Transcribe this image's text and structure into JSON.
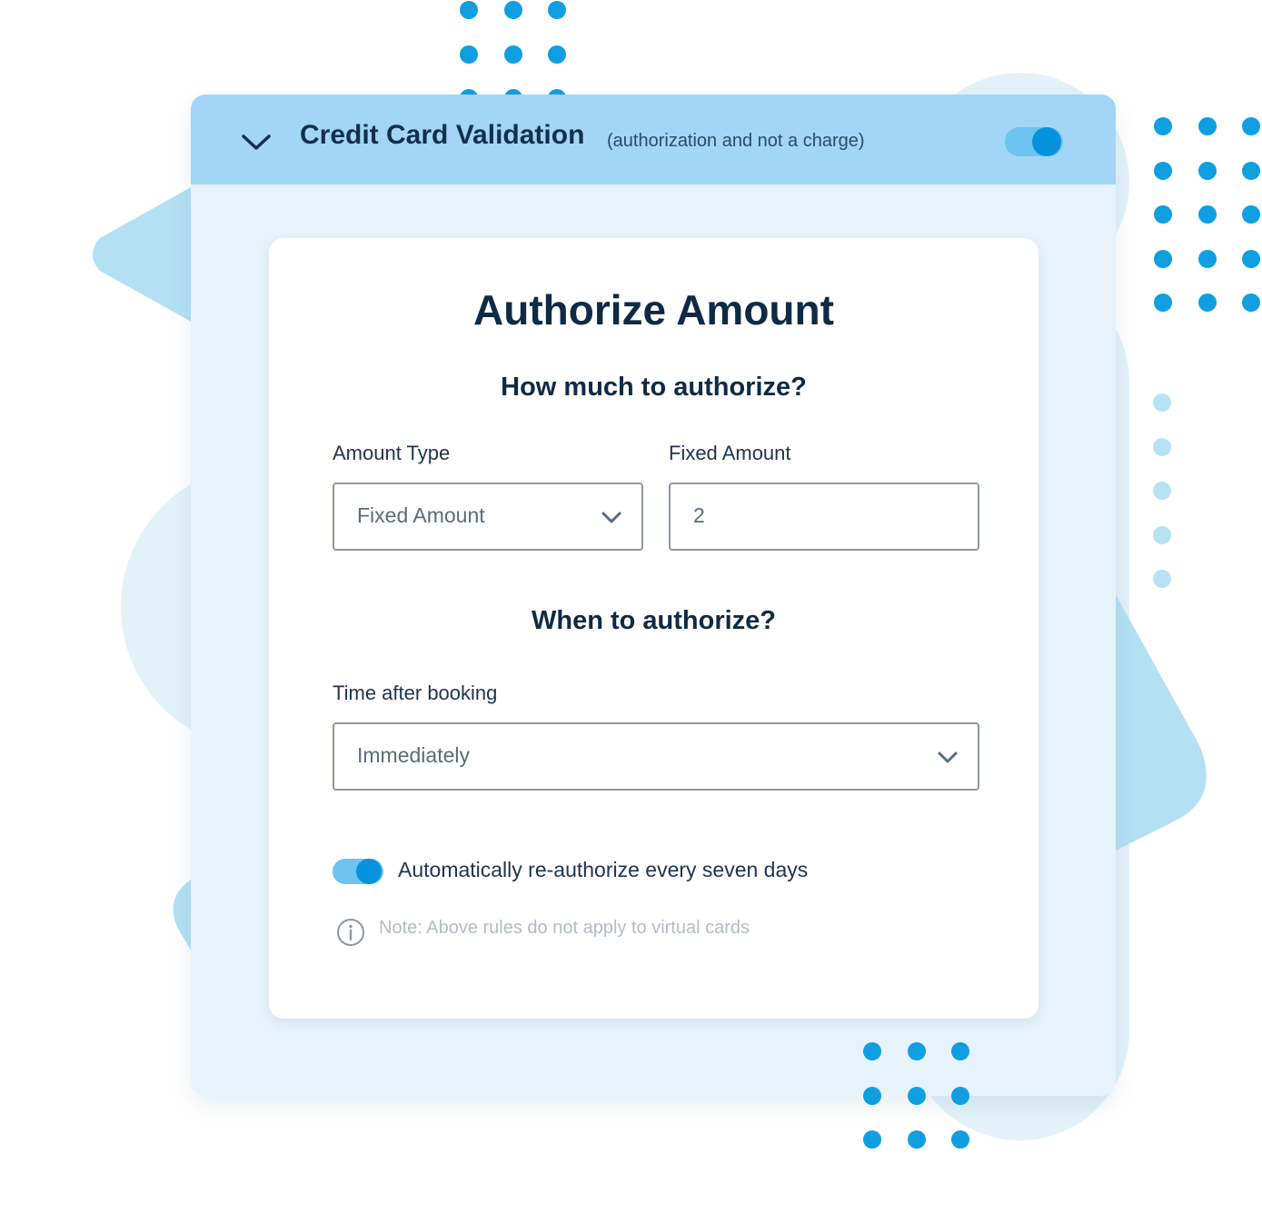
{
  "panel": {
    "title": "Credit Card Validation",
    "subtitle": "(authorization and not a charge)",
    "enabled": true,
    "chevron_icon": "chevron-down-icon",
    "colors": {
      "header": "#a3d5f6",
      "panel_body": "#e6f3fa",
      "accent": "#0593de",
      "accent_light": "#6ec3ef",
      "heading_text": "#0f2a45"
    }
  },
  "card": {
    "title": "Authorize Amount",
    "how_much_heading": "How much to authorize?",
    "amount_type": {
      "label": "Amount Type",
      "value": "Fixed Amount",
      "icon": "chevron-down-icon"
    },
    "fixed_amount": {
      "label": "Fixed Amount",
      "value": "2"
    },
    "when_heading": "When to authorize?",
    "time_after_booking": {
      "label": "Time after booking",
      "value": "Immediately",
      "icon": "chevron-down-icon"
    },
    "reauthorize": {
      "label": "Automatically re-authorize every seven days",
      "enabled": true
    },
    "note": {
      "icon": "info-icon",
      "text": "Note: Above rules do not apply to virtual cards"
    }
  }
}
